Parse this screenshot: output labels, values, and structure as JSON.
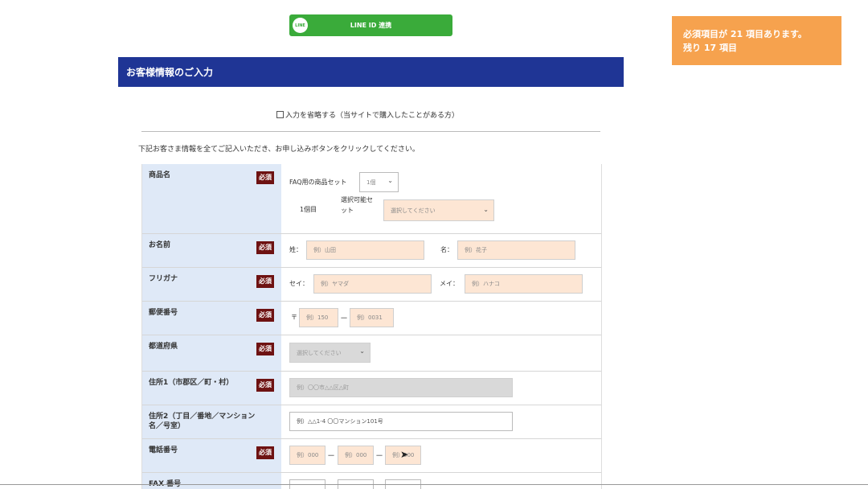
{
  "line_button": {
    "label": "LINE ID 連携",
    "icon_text": "LINE"
  },
  "notice": {
    "line1": "必須項目が 21 項目あります。",
    "line2": "残り 17 項目"
  },
  "header": {
    "title": "お客様情報のご入力"
  },
  "skip_checkbox": {
    "label": "入力を省略する（当サイトで購入したことがある方）"
  },
  "intro_text": "下記お客さま情報を全てご記入いただき、お申し込みボタンをクリックしてください。",
  "required_badge": "必須",
  "rows": {
    "product": {
      "label": "商品名",
      "set_label": "FAQ用の商品セット",
      "set_qty": "1個",
      "item_label": "1個目",
      "choice_label_line1": "選択可能セ",
      "choice_label_line2": "ット",
      "choice_placeholder": "選択してください"
    },
    "name": {
      "label": "お名前",
      "last_label": "姓：",
      "last_placeholder": "例）山田",
      "first_label": "名：",
      "first_placeholder": "例）花子"
    },
    "furigana": {
      "label": "フリガナ",
      "last_label": "セイ：",
      "last_placeholder": "例）ヤマダ",
      "first_label": "メイ：",
      "first_placeholder": "例）ハナコ"
    },
    "postal": {
      "label": "郵便番号",
      "mark": "〒",
      "part1_placeholder": "例）150",
      "dash": "－",
      "part2_placeholder": "例）0031"
    },
    "prefecture": {
      "label": "都道府県",
      "placeholder": "選択してください"
    },
    "address1": {
      "label": "住所1（市郡区／町・村）",
      "placeholder": "例）〇〇市△△区△町"
    },
    "address2": {
      "label": "住所2（丁目／番地／マンション名／号室）",
      "placeholder": "例）△△1-4 〇〇マンション101号"
    },
    "phone": {
      "label": "電話番号",
      "part1_placeholder": "例）000",
      "part2_placeholder": "例）000",
      "part3_placeholder": "例）000",
      "dash": "－"
    },
    "fax": {
      "label": "FAX 番号"
    }
  }
}
